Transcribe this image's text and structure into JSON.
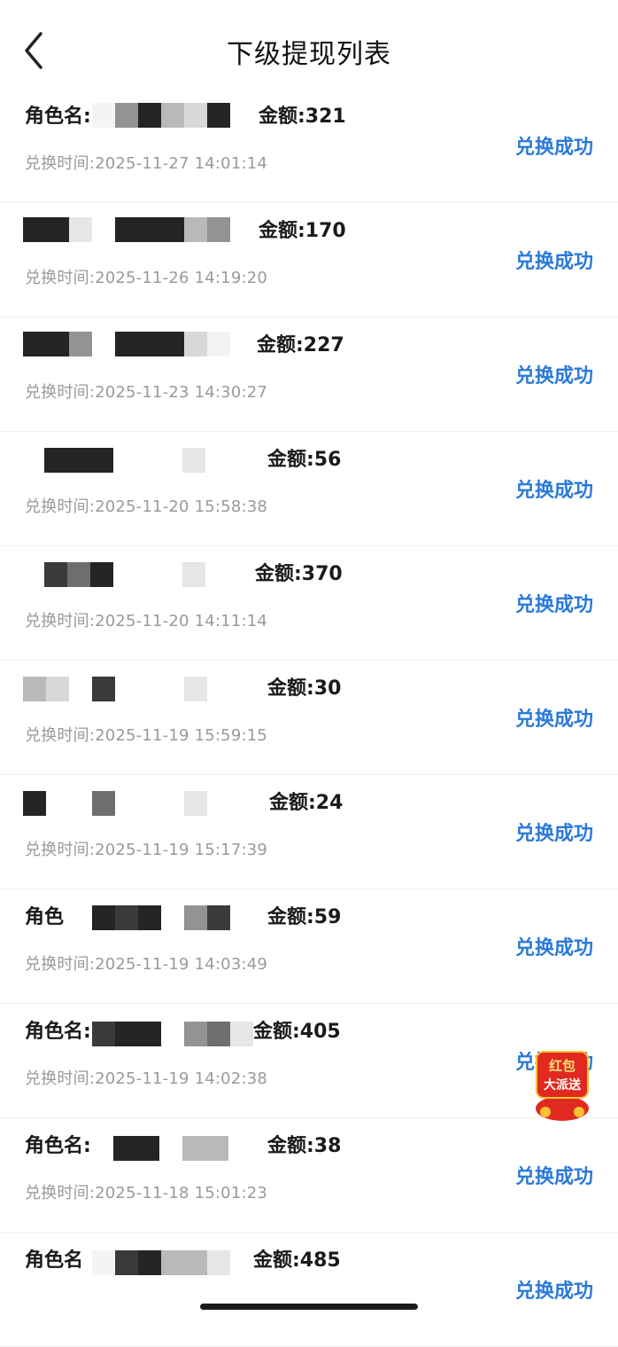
{
  "header": {
    "title": "下级提现列表"
  },
  "records": [
    {
      "name": "角色名:",
      "amount": "金额:321",
      "time": "兑换时间:2025-11-27 14:01:14",
      "status": "兑换成功"
    },
    {
      "name": "",
      "amount": "金额:170",
      "time": "兑换时间:2025-11-26 14:19:20",
      "status": "兑换成功"
    },
    {
      "name": "",
      "amount": "金额:227",
      "time": "兑换时间:2025-11-23 14:30:27",
      "status": "兑换成功"
    },
    {
      "name": "",
      "amount": "金额:56",
      "time": "兑换时间:2025-11-20 15:58:38",
      "status": "兑换成功"
    },
    {
      "name": "",
      "amount": "金额:370",
      "time": "兑换时间:2025-11-20 14:11:14",
      "status": "兑换成功"
    },
    {
      "name": "",
      "amount": "金额:30",
      "time": "兑换时间:2025-11-19 15:59:15",
      "status": "兑换成功"
    },
    {
      "name": "",
      "amount": "金额:24",
      "time": "兑换时间:2025-11-19 15:17:39",
      "status": "兑换成功"
    },
    {
      "name": "角色",
      "amount": "金额:59",
      "time": "兑换时间:2025-11-19 14:03:49",
      "status": "兑换成功"
    },
    {
      "name": "角色名:",
      "amount": "金额:405",
      "time": "兑换时间:2025-11-19 14:02:38",
      "status": "兑换成功"
    },
    {
      "name": "角色名:",
      "amount": "金额:38",
      "time": "兑换时间:2025-11-18 15:01:23",
      "status": "兑换成功"
    },
    {
      "name": "角色名",
      "amount": "金额:485",
      "time": "",
      "status": "兑换成功"
    }
  ],
  "promo": {
    "line1": "红包",
    "line2": "大派送",
    "icon": "red-packet-icon",
    "color": "#e02a1f"
  },
  "colors": {
    "status": "#2a7ad8",
    "time": "#9a9a9a"
  }
}
